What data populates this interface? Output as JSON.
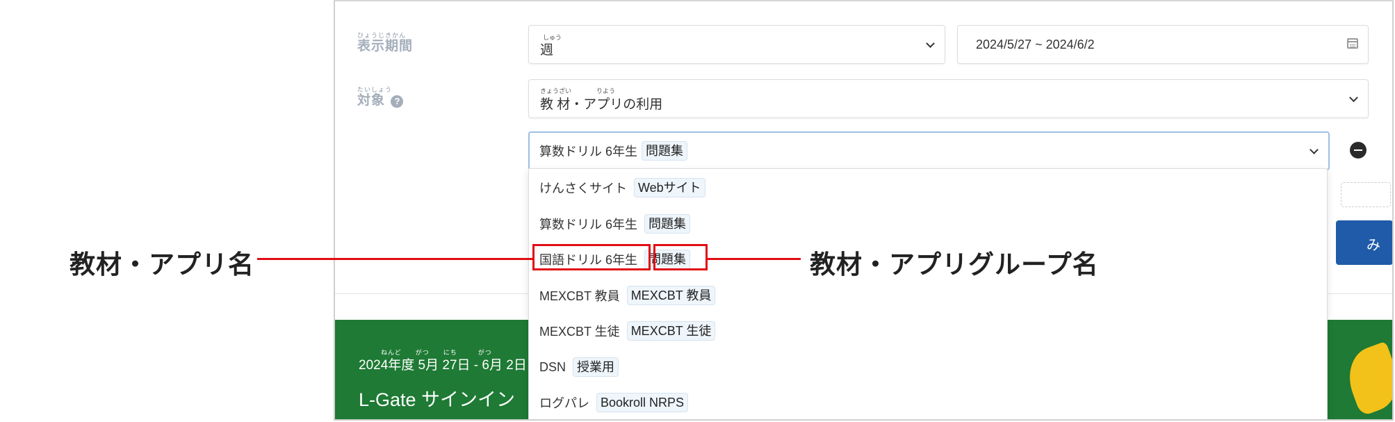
{
  "filter": {
    "period_ruby": "ひょうじきかん",
    "period_label": "表示期間",
    "period_select_ruby": "しゅう",
    "period_select_value": "週",
    "date_range": "2024/5/27 ~ 2024/6/2",
    "target_ruby": "たいしょう",
    "target_label": "対象",
    "target_select_ruby": "きょうざい　　　　りよう",
    "target_select_value": "教 材・アプリの利用",
    "app_select_name": "算数ドリル 6年生",
    "app_select_tag": "問題集",
    "submit_button_partial": "み"
  },
  "dropdown": {
    "items": [
      {
        "name": "けんさくサイト",
        "tag": "Webサイト"
      },
      {
        "name": "算数ドリル 6年生",
        "tag": "問題集"
      },
      {
        "name": "国語ドリル 6年生",
        "tag": "問題集"
      },
      {
        "name": "MEXCBT 教員",
        "tag": "MEXCBT 教員"
      },
      {
        "name": "MEXCBT 生徒",
        "tag": "MEXCBT 生徒"
      },
      {
        "name": "DSN",
        "tag": "授業用"
      },
      {
        "name": "ログパレ",
        "tag": "Bookroll NRPS"
      }
    ]
  },
  "banner": {
    "ruby": "ねんど　　がつ　　にち　　　がつ",
    "date_text": "2024年度 5月 27日 - 6月 2日",
    "title": "L-Gate サインイン"
  },
  "callouts": {
    "left": "教材・アプリ名",
    "right": "教材・アプリグループ名"
  },
  "colors": {
    "highlight": "#e10d15",
    "banner": "#1e7a34",
    "button": "#1f5ba8"
  }
}
